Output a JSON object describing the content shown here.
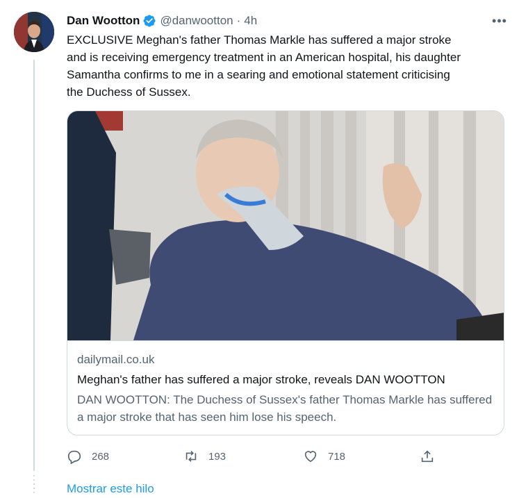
{
  "tweet": {
    "author_name": "Dan Wootton",
    "handle": "@danwootton",
    "separator": "·",
    "time": "4h",
    "more_label": "•••",
    "text": "EXCLUSIVE Meghan's father Thomas Markle has suffered a major stroke\nand is receiving emergency treatment in an American hospital, his daughter\nSamantha confirms to me in a searing and emotional statement criticising\nthe Duchess of Sussex."
  },
  "card": {
    "domain": "dailymail.co.uk",
    "title": "Meghan's father has suffered a major stroke, reveals DAN WOOTTON",
    "description": "DAN WOOTTON: The Duchess of Sussex's father Thomas Markle has suffered a major stroke that has seen him lose his speech."
  },
  "actions": {
    "replies": "268",
    "retweets": "193",
    "likes": "718"
  },
  "show_thread": "Mostrar este hilo",
  "icons": {
    "verified": "verified-badge-icon",
    "reply": "reply-icon",
    "retweet": "retweet-icon",
    "like": "heart-icon",
    "share": "share-icon",
    "more": "more-icon"
  },
  "colors": {
    "accent": "#1d9bf0",
    "secondary_text": "#536471",
    "border": "#cfd9de"
  }
}
